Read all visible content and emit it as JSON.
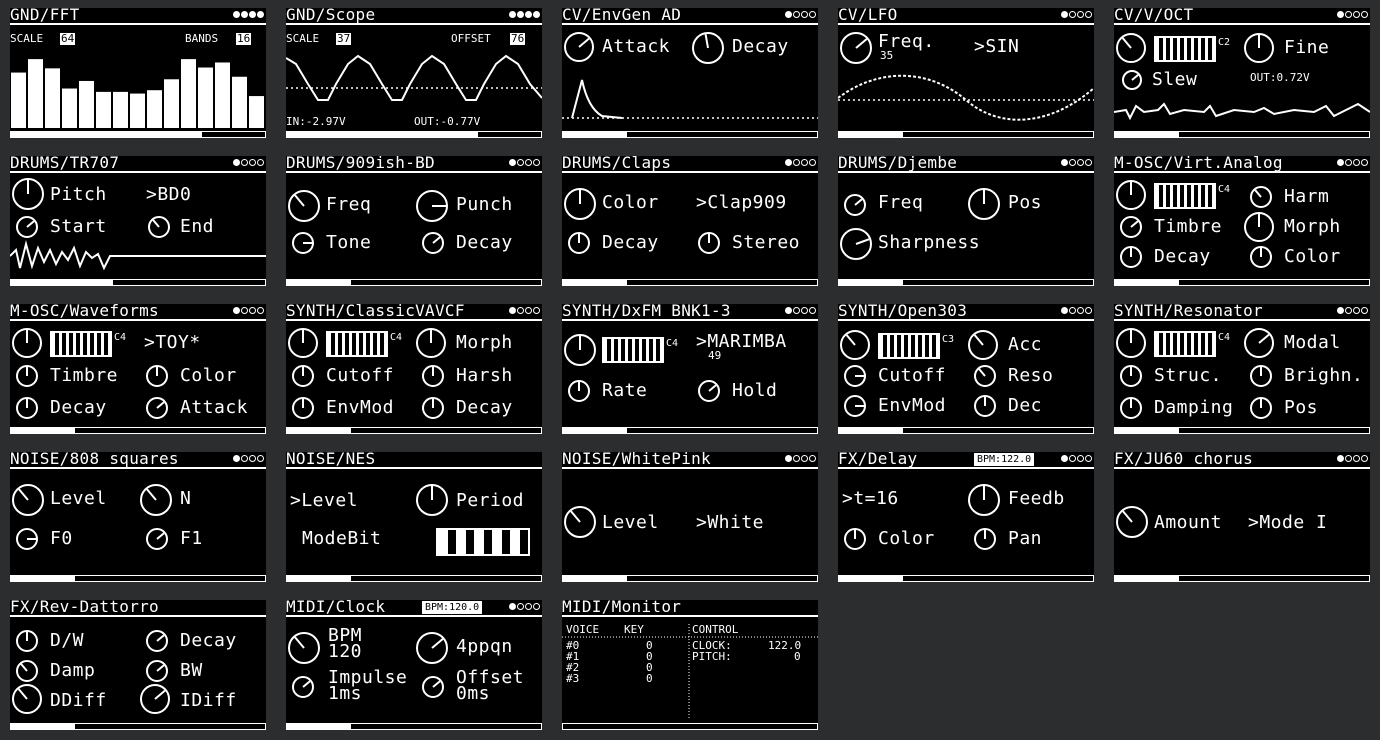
{
  "panels": {
    "p1": {
      "title": "GND/FFT",
      "scale_label": "SCALE",
      "scale_value": "64",
      "bands_label": "BANDS",
      "bands_value": "16",
      "page": 4,
      "progress": 0.75,
      "bars": [
        0.66,
        0.82,
        0.71,
        0.47,
        0.56,
        0.43,
        0.43,
        0.41,
        0.45,
        0.58,
        0.82,
        0.72,
        0.78,
        0.61,
        0.38
      ]
    },
    "p2": {
      "title": "GND/Scope",
      "scale_label": "SCALE",
      "scale_value": "37",
      "offset_label": "OFFSET",
      "offset_value": "76",
      "in_text": "IN:-2.97V",
      "out_text": "OUT:-0.77V",
      "page": 4,
      "progress": 0.75
    },
    "p3": {
      "title": "CV/EnvGen_AD",
      "attack": "Attack",
      "decay": "Decay",
      "page": 1,
      "progress": 0.25
    },
    "p4": {
      "title": "CV/LFO",
      "freq": "Freq.",
      "freq_value": "35",
      "shape": ">SIN",
      "page": 1,
      "progress": 0.25
    },
    "p5": {
      "title": "CV/V/OCT",
      "octave": "C2",
      "fine": "Fine",
      "slew": "Slew",
      "out_text": "OUT:0.72V",
      "page": 1,
      "progress": 0.25
    },
    "p6": {
      "title": "DRUMS/TR707",
      "pitch": "Pitch",
      "sample": ">BD0",
      "start": "Start",
      "end": "End",
      "page": 1,
      "progress": 0.4
    },
    "p7": {
      "title": "DRUMS/909ish-BD",
      "freq": "Freq",
      "punch": "Punch",
      "tone": "Tone",
      "decay": "Decay",
      "page": 1,
      "progress": 0.25
    },
    "p8": {
      "title": "DRUMS/Claps",
      "color": "Color",
      "sample": ">Clap909",
      "decay": "Decay",
      "stereo": "Stereo",
      "page": 1,
      "progress": 0.25
    },
    "p9": {
      "title": "DRUMS/Djembe",
      "freq": "Freq",
      "pos": "Pos",
      "sharpness": "Sharpness",
      "page": 1,
      "progress": 0.25
    },
    "p10": {
      "title": "M-OSC/Virt.Analog",
      "octave": "C4",
      "harm": "Harm",
      "timbre": "Timbre",
      "morph": "Morph",
      "decay": "Decay",
      "color": "Color",
      "page": 1,
      "progress": 0.25
    },
    "p11": {
      "title": "M-OSC/Waveforms",
      "octave": "C4",
      "engine": ">TOY*",
      "timbre": "Timbre",
      "color": "Color",
      "decay": "Decay",
      "attack": "Attack",
      "page": 1,
      "progress": 0.25
    },
    "p12": {
      "title": "SYNTH/ClassicVAVCF",
      "octave": "C4",
      "morph": "Morph",
      "cutoff": "Cutoff",
      "harsh": "Harsh",
      "envmod": "EnvMod",
      "decay": "Decay",
      "page": 1,
      "progress": 0.25
    },
    "p13": {
      "title": "SYNTH/DxFM_BNK1-3",
      "octave": "C4",
      "patch": ">MARIMBA",
      "patch_num": "49",
      "rate": "Rate",
      "hold": "Hold",
      "page": 1,
      "progress": 0.25
    },
    "p14": {
      "title": "SYNTH/Open303",
      "octave": "C3",
      "acc": "Acc",
      "cutoff": "Cutoff",
      "reso": "Reso",
      "envmod": "EnvMod",
      "dec": "Dec",
      "page": 1,
      "progress": 0.25
    },
    "p15": {
      "title": "SYNTH/Resonator",
      "octave": "C4",
      "modal": "Modal",
      "struc": "Struc.",
      "brighn": "Brighn.",
      "damping": "Damping",
      "pos": "Pos",
      "page": 1,
      "progress": 0.25
    },
    "p16": {
      "title": "NOISE/808_squares",
      "level": "Level",
      "n": "N",
      "f0": "F0",
      "f1": "F1",
      "page": 1,
      "progress": 0.25
    },
    "p17": {
      "title": "NOISE/NES",
      "level": ">Level",
      "period": "Period",
      "modebit": "ModeBit",
      "page": 1,
      "progress": 0.25
    },
    "p18": {
      "title": "NOISE/WhitePink",
      "level": "Level",
      "mode": ">White",
      "page": 1,
      "progress": 0.25
    },
    "p19": {
      "title": "FX/Delay",
      "bpm": "BPM:122.0",
      "time": ">t=16",
      "feedb": "Feedb",
      "color": "Color",
      "pan": "Pan",
      "page": 1,
      "progress": 0.25
    },
    "p20": {
      "title": "FX/JU60_chorus",
      "amount": "Amount",
      "mode": ">Mode I",
      "page": 1,
      "progress": 0.25
    },
    "p21": {
      "title": "FX/Rev-Dattorro",
      "dw": "D/W",
      "decay": "Decay",
      "damp": "Damp",
      "bw": "BW",
      "ddiff": "DDiff",
      "idiff": "IDiff",
      "page": 1,
      "progress": 0.25
    },
    "p22": {
      "title": "MIDI/Clock",
      "bpm": "BPM:120.0",
      "bpm_label": "BPM",
      "bpm_value": "120",
      "ppqn": "4ppqn",
      "impulse": "Impulse",
      "impulse_value": "1ms",
      "offset": "Offset",
      "offset_value": "0ms",
      "page": 1,
      "progress": 0.25
    },
    "p23": {
      "title": "MIDI/Monitor",
      "voice_header": "VOICE",
      "key_header": "KEY",
      "control_header": "CONTROL",
      "voices": [
        "#0",
        "#1",
        "#2",
        "#3"
      ],
      "keys": [
        "0",
        "0",
        "0",
        "0"
      ],
      "clock_label": "CLOCK:",
      "clock_value": "122.0",
      "pitch_label": "PITCH:",
      "pitch_value": "0",
      "progress": 0.0
    }
  }
}
